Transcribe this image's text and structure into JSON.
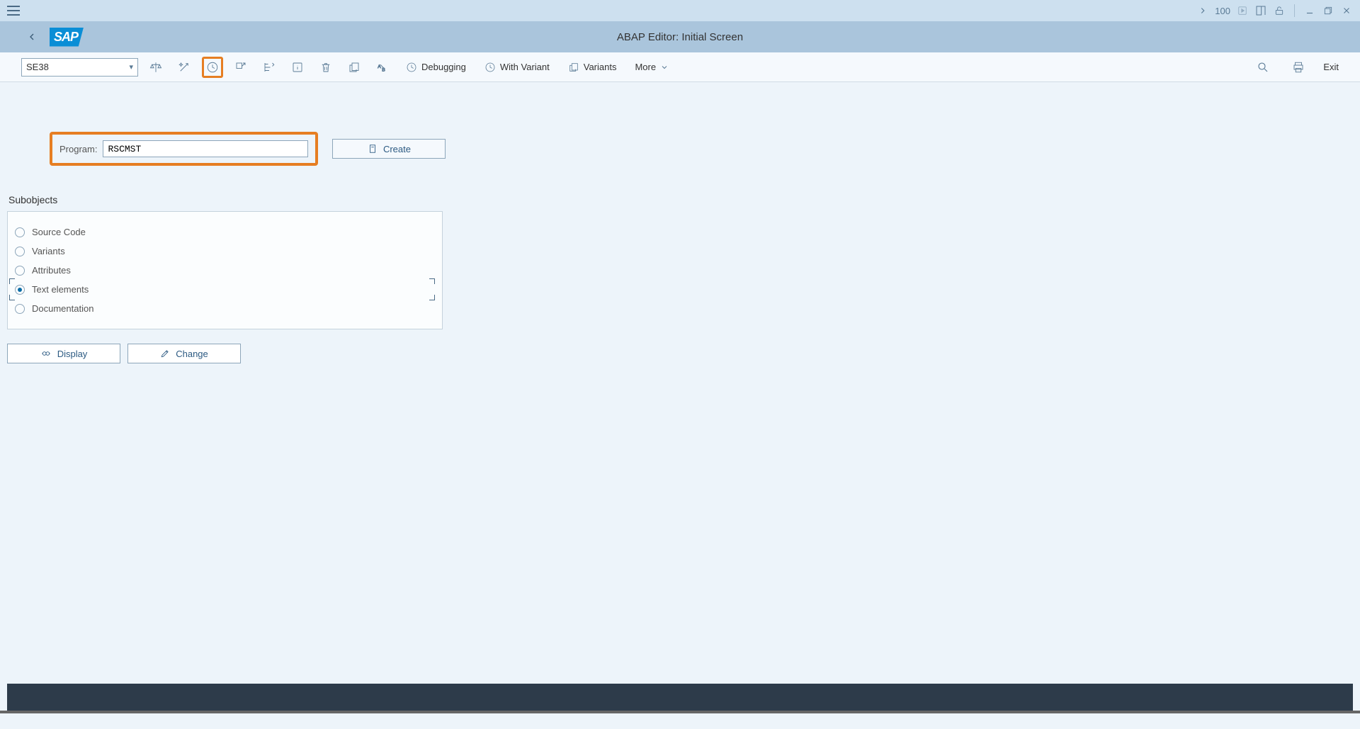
{
  "system_bar": {
    "zoom": "100"
  },
  "header": {
    "title": "ABAP Editor: Initial Screen",
    "logo": "SAP"
  },
  "toolbar": {
    "tcode": "SE38",
    "debugging": "Debugging",
    "with_variant": "With Variant",
    "variants": "Variants",
    "more": "More",
    "exit": "Exit"
  },
  "main": {
    "program_label": "Program:",
    "program_value": "RSCMST",
    "create": "Create",
    "subobjects_label": "Subobjects",
    "subobjects": [
      {
        "label": "Source Code",
        "selected": false
      },
      {
        "label": "Variants",
        "selected": false
      },
      {
        "label": "Attributes",
        "selected": false
      },
      {
        "label": "Text elements",
        "selected": true
      },
      {
        "label": "Documentation",
        "selected": false
      }
    ],
    "display": "Display",
    "change": "Change"
  }
}
